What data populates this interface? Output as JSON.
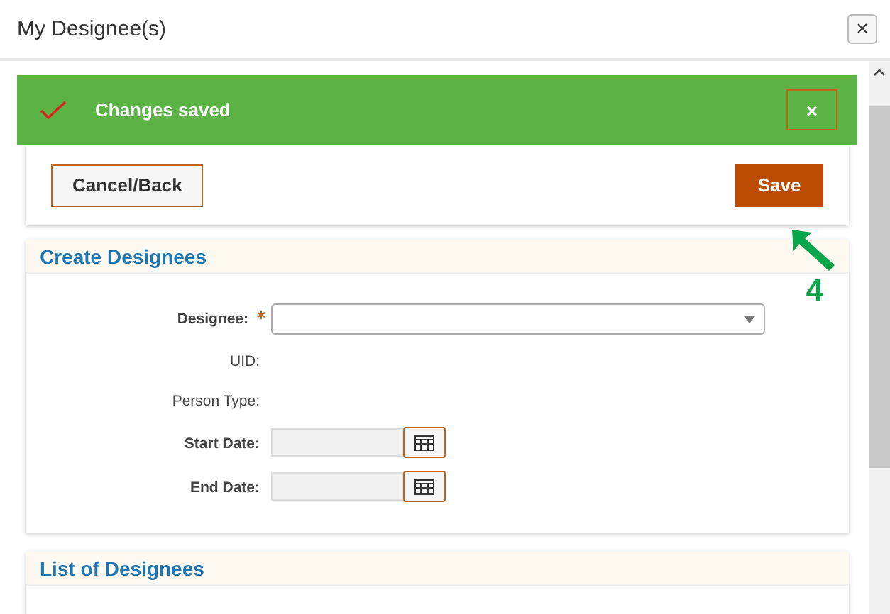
{
  "window": {
    "title": "My Designee(s)",
    "close": "×"
  },
  "alert": {
    "message": "Changes saved",
    "dismiss": "×"
  },
  "actions": {
    "cancel": "Cancel/Back",
    "save": "Save"
  },
  "annotation": {
    "label": "4"
  },
  "create_panel": {
    "title": "Create Designees",
    "fields": [
      {
        "label": "Designee:",
        "kind": "select",
        "required": true
      },
      {
        "label": "UID:",
        "kind": "info",
        "required": false
      },
      {
        "label": "Person Type:",
        "kind": "info",
        "required": false
      },
      {
        "label": "Start Date:",
        "kind": "date",
        "required": false
      },
      {
        "label": "End Date:",
        "kind": "date",
        "required": false
      }
    ]
  },
  "list_panel": {
    "title": "List of Designees"
  }
}
